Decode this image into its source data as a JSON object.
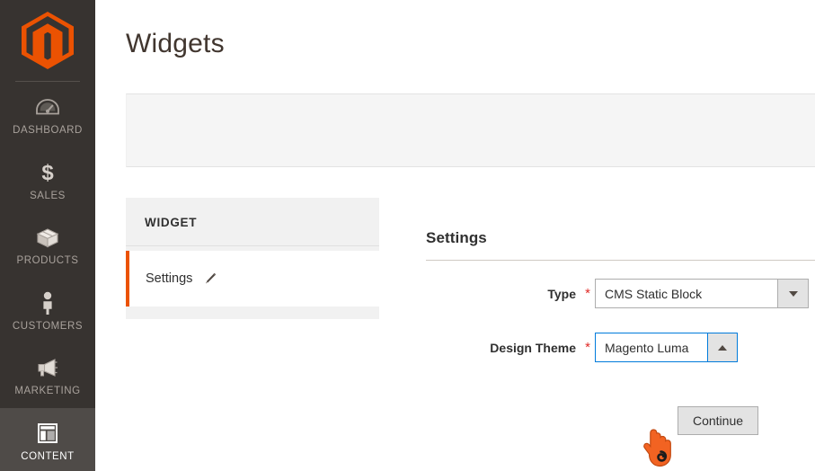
{
  "sidebar": {
    "logo": {
      "name": "magento-logo",
      "color": "#eb5202"
    },
    "items": [
      {
        "label": "DASHBOARD",
        "icon": "dashboard-gauge-icon",
        "active": false
      },
      {
        "label": "SALES",
        "icon": "dollar-sign-icon",
        "active": false
      },
      {
        "label": "PRODUCTS",
        "icon": "box-icon",
        "active": false
      },
      {
        "label": "CUSTOMERS",
        "icon": "person-icon",
        "active": false
      },
      {
        "label": "MARKETING",
        "icon": "megaphone-icon",
        "active": false
      },
      {
        "label": "CONTENT",
        "icon": "page-layout-icon",
        "active": true
      }
    ]
  },
  "page": {
    "title": "Widgets"
  },
  "widget_card": {
    "header": "WIDGET",
    "tabs": [
      {
        "label": "Settings",
        "icon": "pencil-icon",
        "active": true
      }
    ]
  },
  "settings": {
    "title": "Settings",
    "fields": [
      {
        "label": "Type",
        "required_marker": "*",
        "value": "CMS Static Block",
        "arrow": "chevron-down-icon",
        "focused": false
      },
      {
        "label": "Design Theme",
        "required_marker": "*",
        "value": "Magento Luma",
        "arrow": "chevron-up-icon",
        "focused": true
      }
    ],
    "continue_label": "Continue"
  },
  "colors": {
    "accent_orange": "#eb5202",
    "sidebar_bg": "#373330",
    "sidebar_active_bg": "#4f4b48",
    "focus_blue": "#007bdb",
    "required_red": "#e02b27"
  },
  "cursor": {
    "type": "pointing-hand-cursor",
    "color": "#f26322"
  }
}
